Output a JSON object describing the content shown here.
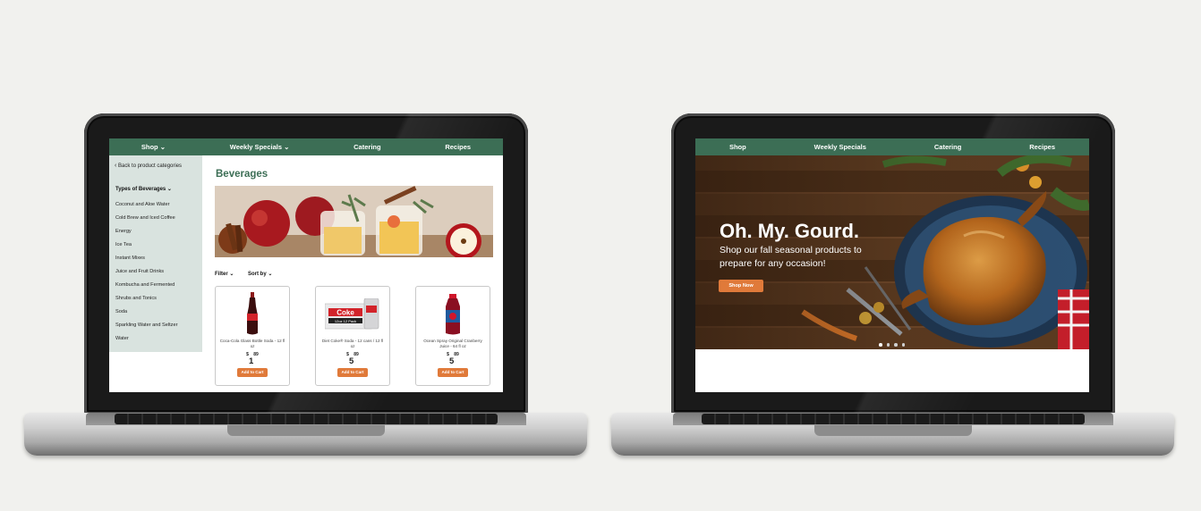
{
  "left_screen": {
    "nav": [
      "Shop",
      "Weekly Specials",
      "Catering",
      "Recipes"
    ],
    "back_link": "Back to product categories",
    "category_heading": "Types of Beverages",
    "categories": [
      "Coconut and Aloe Water",
      "Cold Brew and Iced Coffee",
      "Energy",
      "Ice Tea",
      "Instant Mixes",
      "Juice and Fruit Drinks",
      "Kombucha and Fermented",
      "Shrubs and Tonics",
      "Soda",
      "Sparkling Water and Seltzer",
      "Water"
    ],
    "page_title": "Beverages",
    "filter_label": "Filter",
    "sort_label": "Sort by",
    "products": [
      {
        "name": "Coca-Cola Glass Bottle Soda - 12 fl oz",
        "currency": "$",
        "dollars": "1",
        "cents": "89",
        "button": "Add to Cart"
      },
      {
        "name": "Diet Coke® Soda - 12 cans / 12 fl oz",
        "currency": "$",
        "dollars": "5",
        "cents": "89",
        "button": "Add to Cart"
      },
      {
        "name": "Ocean Spray Original Cranberry Juice - 64 fl oz",
        "currency": "$",
        "dollars": "5",
        "cents": "89",
        "button": "Add to Cart"
      }
    ],
    "pack_label": "Coke",
    "pack_sub": "12oz 12 Pack"
  },
  "right_screen": {
    "nav": [
      "Shop",
      "Weekly Specials",
      "Catering",
      "Recipes"
    ],
    "hero_title": "Oh. My. Gourd.",
    "hero_subtitle": "Shop our fall seasonal products to prepare for any occasion!",
    "cta": "Shop Now",
    "carousel_slide_count": 4,
    "carousel_active": 1
  },
  "colors": {
    "brand_green": "#3c6e55",
    "accent_orange": "#e07a3a",
    "sidebar_bg": "#d9e3df",
    "background": "#f1f1ee"
  }
}
